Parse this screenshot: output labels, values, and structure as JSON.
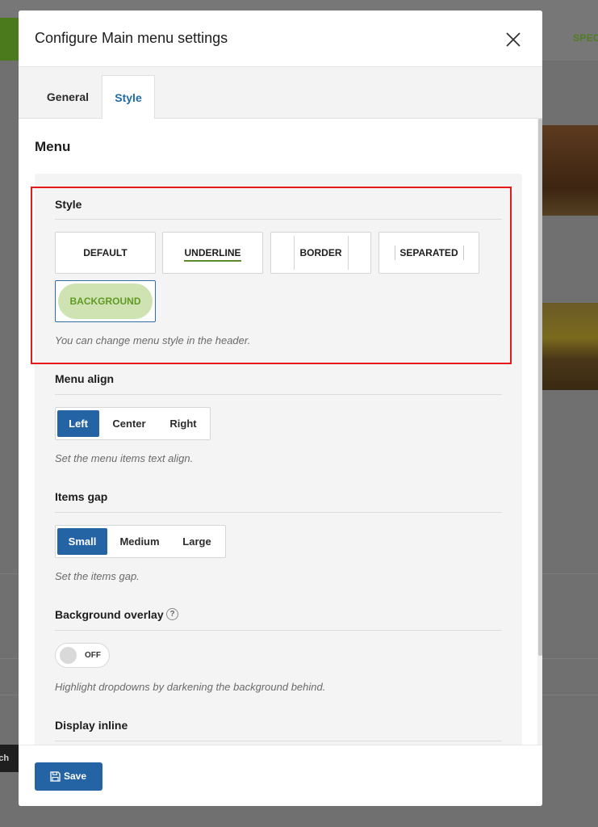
{
  "background": {
    "spec_text": "SPEC",
    "search_text": "rch"
  },
  "modal": {
    "title": "Configure Main menu settings",
    "close_icon": "close-icon"
  },
  "tabs": [
    {
      "label": "General",
      "active": false
    },
    {
      "label": "Style",
      "active": true
    }
  ],
  "section": {
    "title": "Menu"
  },
  "style_field": {
    "label": "Style",
    "options": [
      "DEFAULT",
      "UNDERLINE",
      "BORDER",
      "SEPARATED",
      "BACKGROUND"
    ],
    "selected": "BACKGROUND",
    "help": "You can change menu style in the header."
  },
  "menu_align": {
    "label": "Menu align",
    "options": [
      "Left",
      "Center",
      "Right"
    ],
    "selected": "Left",
    "help": "Set the menu items text align."
  },
  "items_gap": {
    "label": "Items gap",
    "options": [
      "Small",
      "Medium",
      "Large"
    ],
    "selected": "Small",
    "help": "Set the items gap."
  },
  "background_overlay": {
    "label": "Background overlay",
    "help_icon": "?",
    "toggle_label": "OFF",
    "help": "Highlight dropdowns by darkening the background behind."
  },
  "display_inline": {
    "label": "Display inline"
  },
  "footer": {
    "save_label": "Save",
    "save_icon": "save-icon"
  },
  "colors": {
    "accent": "#2564a4",
    "active_tab": "#1f6ba8",
    "highlight": "#e51a1a",
    "pill_bg": "#cfe3b2",
    "pill_text": "#5f9a23"
  }
}
